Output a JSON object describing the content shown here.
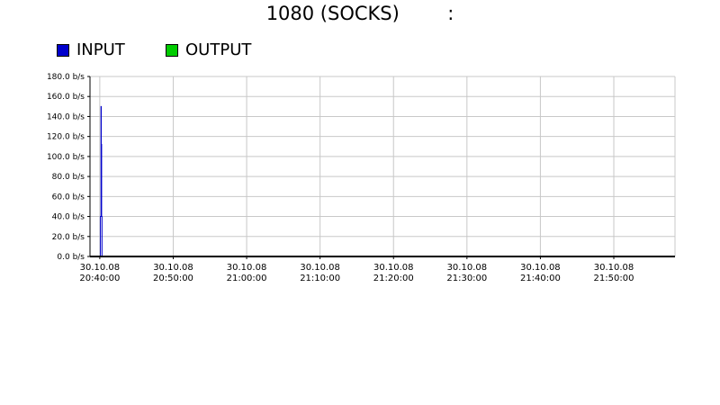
{
  "title": "1080 (SOCKS)        :",
  "legend": [
    {
      "label": "INPUT",
      "color": "#0000cc"
    },
    {
      "label": "OUTPUT",
      "color": "#00cc00"
    }
  ],
  "chart_data": {
    "type": "line",
    "title": "1080 (SOCKS)        :",
    "xlabel": "",
    "ylabel": "",
    "ylim": [
      0,
      180
    ],
    "y_unit": "b/s",
    "y_ticks": [
      "0.0 b/s",
      "20.0 b/s",
      "40.0 b/s",
      "60.0 b/s",
      "80.0 b/s",
      "100.0 b/s",
      "120.0 b/s",
      "140.0 b/s",
      "160.0 b/s",
      "180.0 b/s"
    ],
    "y_tick_values": [
      0,
      20,
      40,
      60,
      80,
      100,
      120,
      140,
      160,
      180
    ],
    "x_ticks": [
      {
        "time": "2008-10-30 20:40:00",
        "date": "30.10.08",
        "clock": "20:40:00"
      },
      {
        "time": "2008-10-30 20:50:00",
        "date": "30.10.08",
        "clock": "20:50:00"
      },
      {
        "time": "2008-10-30 21:00:00",
        "date": "30.10.08",
        "clock": "21:00:00"
      },
      {
        "time": "2008-10-30 21:10:00",
        "date": "30.10.08",
        "clock": "21:10:00"
      },
      {
        "time": "2008-10-30 21:20:00",
        "date": "30.10.08",
        "clock": "21:20:00"
      },
      {
        "time": "2008-10-30 21:30:00",
        "date": "30.10.08",
        "clock": "21:30:00"
      },
      {
        "time": "2008-10-30 21:40:00",
        "date": "30.10.08",
        "clock": "21:40:00"
      },
      {
        "time": "2008-10-30 21:50:00",
        "date": "30.10.08",
        "clock": "21:50:00"
      }
    ],
    "xlim": [
      "2008-10-30 20:38:40",
      "2008-10-30 21:58:20"
    ],
    "grid": true,
    "legend_position": "top-left",
    "series": [
      {
        "name": "INPUT",
        "color": "#0000cc",
        "points": [
          {
            "x": "2008-10-30 20:38:40",
            "y": 0
          },
          {
            "x": "2008-10-30 20:40:05",
            "y": 0
          },
          {
            "x": "2008-10-30 20:40:05",
            "y": 40
          },
          {
            "x": "2008-10-30 20:40:10",
            "y": 40
          },
          {
            "x": "2008-10-30 20:40:10",
            "y": 150
          },
          {
            "x": "2008-10-30 20:40:12",
            "y": 150
          },
          {
            "x": "2008-10-30 20:40:12",
            "y": 112
          },
          {
            "x": "2008-10-30 20:40:15",
            "y": 112
          },
          {
            "x": "2008-10-30 20:40:15",
            "y": 40
          },
          {
            "x": "2008-10-30 20:40:18",
            "y": 40
          },
          {
            "x": "2008-10-30 20:40:18",
            "y": 0
          },
          {
            "x": "2008-10-30 21:58:20",
            "y": 0
          }
        ]
      },
      {
        "name": "OUTPUT",
        "color": "#00cc00",
        "points": [
          {
            "x": "2008-10-30 20:38:40",
            "y": 0
          },
          {
            "x": "2008-10-30 21:58:20",
            "y": 0
          }
        ]
      }
    ]
  }
}
